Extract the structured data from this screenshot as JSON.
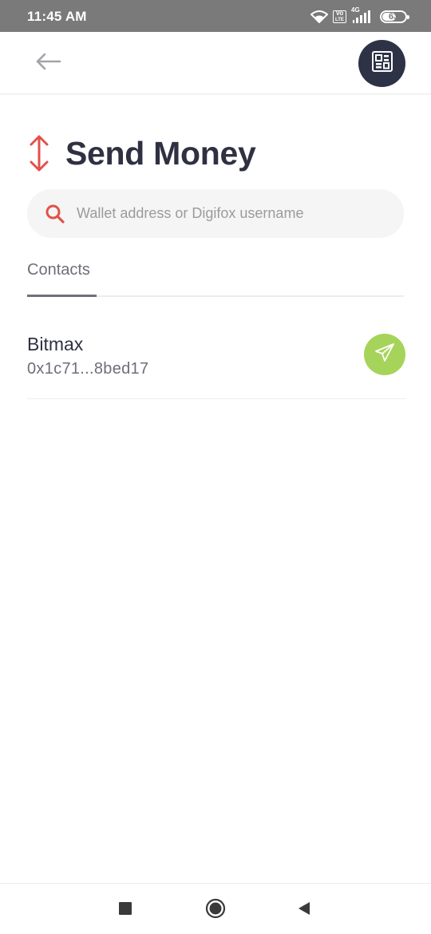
{
  "status_bar": {
    "time": "11:45 AM",
    "volte_top": "Vo",
    "volte_bottom": "LTE",
    "network_type": "4G",
    "battery_level": 63,
    "battery_label": "63",
    "icons": [
      "wifi-icon",
      "volte-icon",
      "signal-icon",
      "battery-icon"
    ]
  },
  "app_bar": {
    "back_icon": "arrow-left-icon",
    "qr_icon": "qr-code-icon"
  },
  "page": {
    "title": "Send Money",
    "title_icon": "up-down-arrow-icon"
  },
  "search": {
    "placeholder": "Wallet address or Digifox username",
    "value": "",
    "icon": "search-icon"
  },
  "tabs": [
    {
      "label": "Contacts",
      "active": true
    }
  ],
  "contacts": [
    {
      "name": "Bitmax",
      "address": "0x1c71...8bed17",
      "action_icon": "paper-plane-icon"
    }
  ],
  "nav_bar": {
    "buttons": [
      "recents-square-icon",
      "home-circle-icon",
      "back-triangle-icon"
    ]
  },
  "colors": {
    "primary_dark": "#2e3246",
    "accent_red": "#e0524a",
    "send_green": "#a6d45a",
    "status_bar": "#7a7a7a",
    "search_bg": "#f5f5f5"
  }
}
